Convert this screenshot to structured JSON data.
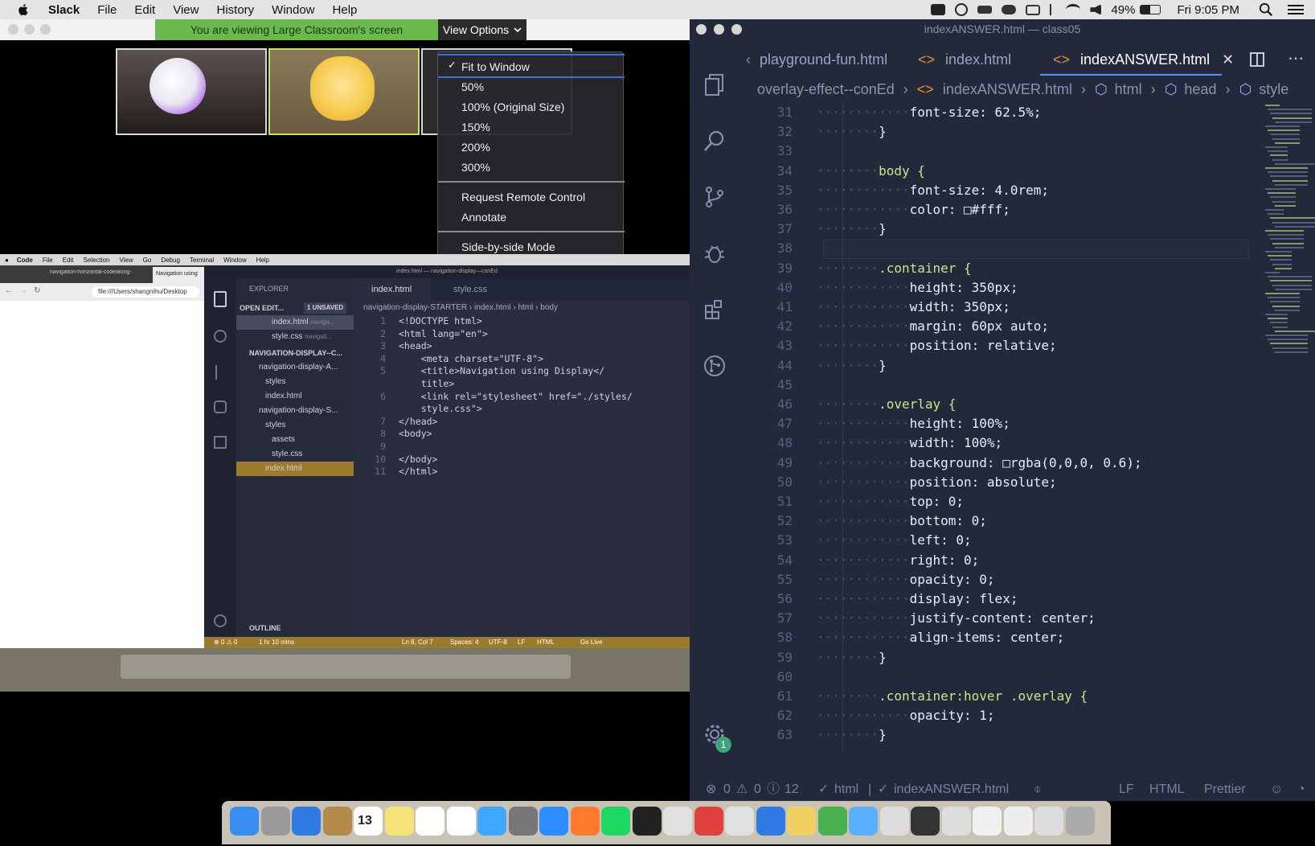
{
  "menubar": {
    "app": "Slack",
    "items": [
      "File",
      "Edit",
      "View",
      "History",
      "Window",
      "Help"
    ],
    "battery": "49%",
    "clock": "Fri 9:05 PM"
  },
  "zoom": {
    "banner": "You are viewing Large Classroom's screen",
    "view_options": "View Options",
    "menu": {
      "zoom_items": [
        "Fit to Window",
        "50%",
        "100% (Original Size)",
        "150%",
        "200%",
        "300%"
      ],
      "action_items": [
        "Request Remote Control",
        "Annotate"
      ],
      "mode_items": [
        "Side-by-side Mode"
      ]
    }
  },
  "mini": {
    "menubar": [
      "Code",
      "File",
      "Edit",
      "Selection",
      "View",
      "Go",
      "Debug",
      "Terminal",
      "Window",
      "Help"
    ],
    "browser_tabs": [
      "navigation-horizontal-codealong-",
      "Navigation using"
    ],
    "url": "file:///Users/shangnihu/Desktop",
    "window_title": "index.html — navigation-display—conEd",
    "explorer_title": "EXPLORER",
    "open_editors": "OPEN EDIT...",
    "unsaved": "1 UNSAVED",
    "open_files": [
      "index.html",
      "style.css"
    ],
    "open_paths": [
      "naviga...",
      "navigati..."
    ],
    "project": "NAVIGATION-DISPLAY--C...",
    "tree": [
      "navigation-display-A...",
      "styles",
      "index.html",
      "navigation-display-S...",
      "styles",
      "assets",
      "style.css",
      "index.html"
    ],
    "outline": "OUTLINE",
    "tabs": [
      "index.html",
      "style.css"
    ],
    "breadcrumb": [
      "navigation-display-STARTER",
      "index.html",
      "html",
      "body"
    ],
    "code": [
      {
        "n": "1",
        "t": "<!DOCTYPE html>"
      },
      {
        "n": "2",
        "t": "<html lang=\"en\">"
      },
      {
        "n": "3",
        "t": "<head>"
      },
      {
        "n": "4",
        "t": "    <meta charset=\"UTF-8\">"
      },
      {
        "n": "5",
        "t": "    <title>Navigation using Display</"
      },
      {
        "n": "",
        "t": "    title>"
      },
      {
        "n": "6",
        "t": "    <link rel=\"stylesheet\" href=\"./styles/"
      },
      {
        "n": "",
        "t": "    style.css\">"
      },
      {
        "n": "7",
        "t": "</head>"
      },
      {
        "n": "8",
        "t": "<body>"
      },
      {
        "n": "9",
        "t": ""
      },
      {
        "n": "10",
        "t": "</body>"
      },
      {
        "n": "11",
        "t": "</html>"
      }
    ],
    "status": {
      "problems": "⊗ 0 ⚠ 0",
      "timer": "1 hr 10 mins",
      "position": "Ln 8, Col 7",
      "spaces": "Spaces: 4",
      "encoding": "UTF-8",
      "eol": "LF",
      "lang": "HTML",
      "live": "Go Live"
    }
  },
  "vscode": {
    "title": "indexANSWER.html — class05",
    "tabs": [
      "playground-fun.html",
      "index.html",
      "indexANSWER.html"
    ],
    "breadcrumb": [
      "overlay-effect--conEd",
      "indexANSWER.html",
      "html",
      "head",
      "style"
    ],
    "lines": [
      {
        "n": "31",
        "d": "············",
        "c": "font-size: 62.5%;"
      },
      {
        "n": "32",
        "d": "········",
        "c": "}"
      },
      {
        "n": "33",
        "d": "",
        "c": ""
      },
      {
        "n": "34",
        "d": "········",
        "c": "body {"
      },
      {
        "n": "35",
        "d": "············",
        "c": "font-size: 4.0rem;"
      },
      {
        "n": "36",
        "d": "············",
        "c": "color: □#fff;"
      },
      {
        "n": "37",
        "d": "········",
        "c": "}"
      },
      {
        "n": "38",
        "d": "",
        "c": ""
      },
      {
        "n": "39",
        "d": "········",
        "c": ".container {"
      },
      {
        "n": "40",
        "d": "············",
        "c": "height: 350px;"
      },
      {
        "n": "41",
        "d": "············",
        "c": "width: 350px;"
      },
      {
        "n": "42",
        "d": "············",
        "c": "margin: 60px auto;"
      },
      {
        "n": "43",
        "d": "············",
        "c": "position: relative;"
      },
      {
        "n": "44",
        "d": "········",
        "c": "}"
      },
      {
        "n": "45",
        "d": "",
        "c": ""
      },
      {
        "n": "46",
        "d": "········",
        "c": ".overlay {"
      },
      {
        "n": "47",
        "d": "············",
        "c": "height: 100%;"
      },
      {
        "n": "48",
        "d": "············",
        "c": "width: 100%;"
      },
      {
        "n": "49",
        "d": "············",
        "c": "background: □rgba(0,0,0, 0.6);"
      },
      {
        "n": "50",
        "d": "············",
        "c": "position: absolute;"
      },
      {
        "n": "51",
        "d": "············",
        "c": "top: 0;"
      },
      {
        "n": "52",
        "d": "············",
        "c": "bottom: 0;"
      },
      {
        "n": "53",
        "d": "············",
        "c": "left: 0;"
      },
      {
        "n": "54",
        "d": "············",
        "c": "right: 0;"
      },
      {
        "n": "55",
        "d": "············",
        "c": "opacity: 0;"
      },
      {
        "n": "56",
        "d": "············",
        "c": "display: flex;"
      },
      {
        "n": "57",
        "d": "············",
        "c": "justify-content: center;"
      },
      {
        "n": "58",
        "d": "············",
        "c": "align-items: center;"
      },
      {
        "n": "59",
        "d": "········",
        "c": "}"
      },
      {
        "n": "60",
        "d": "",
        "c": ""
      },
      {
        "n": "61",
        "d": "········",
        "c": ".container:hover .overlay {"
      },
      {
        "n": "62",
        "d": "············",
        "c": "opacity: 1;"
      },
      {
        "n": "63",
        "d": "········",
        "c": "}"
      }
    ],
    "status": {
      "errors": "0",
      "warnings": "0",
      "info": "12",
      "lang_check": "html",
      "file": "indexANSWER.html",
      "eol": "LF",
      "lang": "HTML",
      "formatter": "Prettier"
    },
    "settings_badge": "1"
  },
  "dock": {
    "calendar_day": "13"
  }
}
